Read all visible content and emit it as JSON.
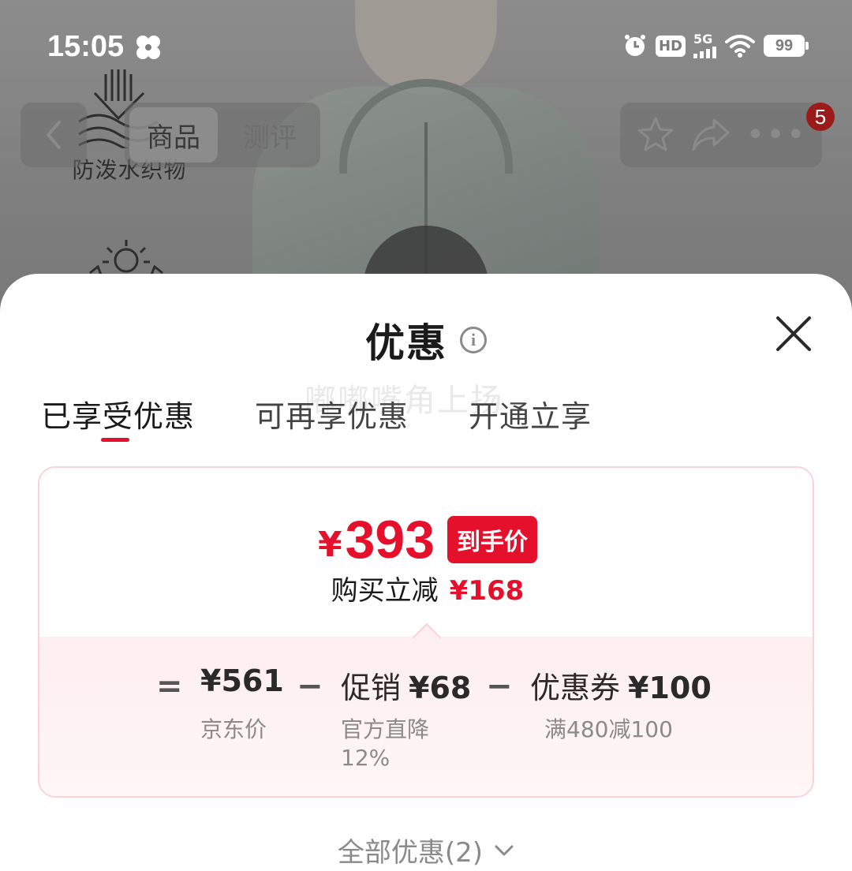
{
  "status_bar": {
    "time": "15:05",
    "hd": "HD",
    "network": "5G",
    "battery": "99"
  },
  "background": {
    "feature_label": "防泼水织物",
    "nav_tabs": [
      "商品",
      "测评"
    ],
    "notification_count": "5",
    "watermark": "嘟嘟嘴角上扬"
  },
  "sheet": {
    "title": "优惠",
    "tabs": [
      "已享受优惠",
      "可再享优惠",
      "开通立享"
    ],
    "active_tab_index": 0,
    "accent_color": "#e5102b",
    "final_price": {
      "currency": "¥",
      "amount": "393",
      "tag": "到手价"
    },
    "saving": {
      "label": "购买立减",
      "amount": "¥168"
    },
    "breakdown": {
      "equals": "=",
      "minus": "−",
      "jd_price": {
        "amount": "¥561",
        "sub": "京东价"
      },
      "promo": {
        "label": "促销",
        "amount": "¥68",
        "sub": "官方直降",
        "sub2": "12%"
      },
      "coupon": {
        "label": "优惠券",
        "amount": "¥100",
        "sub": "满480减100"
      }
    },
    "all_offers": "全部优惠(2)"
  }
}
